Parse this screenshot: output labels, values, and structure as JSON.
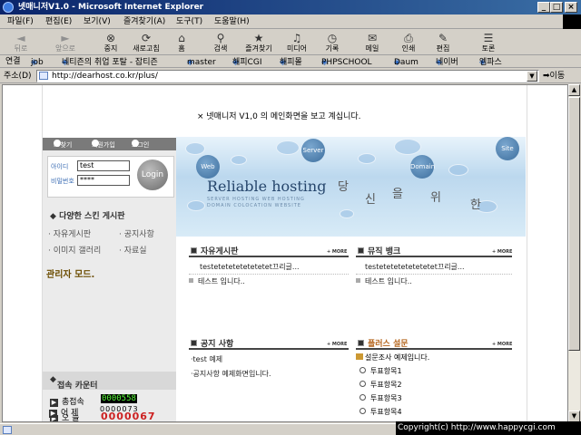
{
  "window": {
    "title": "넷매니저V1.0 - Microsoft Internet Explorer"
  },
  "menu": [
    "파일(F)",
    "편집(E)",
    "보기(V)",
    "즐겨찾기(A)",
    "도구(T)",
    "도움말(H)"
  ],
  "toolbar": {
    "back": "뒤로",
    "forward": "앞으로",
    "stop": "중지",
    "refresh": "새로고침",
    "home": "홈",
    "search": "검색",
    "favorites": "즐겨찾기",
    "media": "미디어",
    "history": "기록",
    "mail": "메일",
    "print": "인쇄",
    "edit": "편집",
    "discuss": "토론"
  },
  "links": {
    "label": "연결",
    "items": [
      "job",
      "네티즌의 취업 포탈 - 잡티즌",
      "master",
      "해피CGI",
      "해피몰",
      "PHPSCHOOL",
      "Daum",
      "네이버",
      "엠파스"
    ]
  },
  "address": {
    "label": "주소(D)",
    "url": "http://dearhost.co.kr/plus/",
    "go": "이동"
  },
  "page": {
    "welcome": "× 넷매니저 V1,0 의 메인화면을 보고 계십니다.",
    "login_tabs": [
      "ID찾기",
      "회원가입",
      "로그인"
    ],
    "id_label": "아이디",
    "id_value": "test",
    "pw_label": "비밀번호",
    "pw_value": "****",
    "login_button": "Login",
    "skin_title": "다양한 스킨 게시판",
    "skin_items": [
      "자유게시판",
      "공지사항",
      "이미지 갤러리",
      "자료실"
    ],
    "admin_mode": "관리자 모드.",
    "counter_title": "접속 카운터",
    "counter": {
      "total_label": "총접속",
      "total": "0000558",
      "today_label": "오 늘",
      "today": "0000067",
      "yesterday_label": "어 제",
      "yesterday": "0000073"
    },
    "banner": {
      "brand": "Reliable hosting",
      "sub1": "SERVER HOSTING WEB HOSTING",
      "sub2": "DOMAIN COLOCATION WEBSITE",
      "chars": [
        "당",
        "신",
        "을",
        "위",
        "한"
      ],
      "bubbles": [
        "Web",
        "Server",
        "Domain",
        "Site"
      ]
    },
    "boards": {
      "free": {
        "title": "자유게시판",
        "more": "+ MORE",
        "items": [
          "testetetetetetetetet끄리글...",
          "테스트 입니다.."
        ]
      },
      "music": {
        "title": "뮤직 뱅크",
        "more": "+ MORE",
        "items": [
          "testetetetetetetetet끄리글...",
          "테스트 입니다.."
        ]
      },
      "notice": {
        "title": "공지 사항",
        "more": "+ MORE",
        "items": [
          "·test 예제",
          "·공지사항 예제화면입니다."
        ]
      },
      "poll": {
        "title": "플러스 설문",
        "more": "+ MORE",
        "question": "설문조사 예제입니다.",
        "options": [
          "투표항목1",
          "투표항목2",
          "투표항목3",
          "투표항목4"
        ]
      }
    }
  },
  "status": {
    "copyright": "Copyright(c) http://www.happycgi.com"
  }
}
